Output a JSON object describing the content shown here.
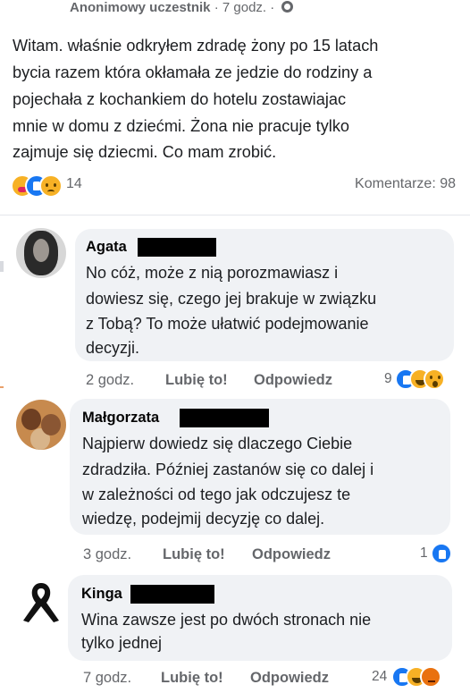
{
  "post": {
    "author": "Anonimowy uczestnik",
    "time": "7 godz.",
    "time_separator": "·",
    "lines": [
      "Witam. właśnie odkryłem zdradę żony po 15 latach",
      "bycia razem która okłamała  ze jedzie do rodziny a",
      "pojechała z kochankiem do hotelu zostawiajac",
      "mnie w domu z dziećmi. Żona nie pracuje tylko",
      "zajmuje się dziecmi. Co mam zrobić."
    ],
    "reaction_count": "14",
    "reaction_icons": [
      "care-icon",
      "like-icon",
      "sad-icon"
    ],
    "comments_label": "Komentarze: 98"
  },
  "comments": [
    {
      "name": "Agata",
      "lines": [
        "No cóż, może z nią porozmawiasz i",
        "dowiesz się, czego jej brakuje w związku",
        "z Tobą? To może ułatwić podejmowanie",
        "decyzji."
      ],
      "time": "2 godz.",
      "like_label": "Lubię to!",
      "reply_label": "Odpowiedz",
      "reaction_count": "9",
      "reaction_icons": [
        "like-icon",
        "haha-icon",
        "wow-icon"
      ]
    },
    {
      "name": "Małgorzata",
      "lines": [
        "Najpierw dowiedz się dlaczego Ciebie",
        "zdradziła. Później zastanów się co dalej i",
        "w zależności od tego jak odczujesz te",
        "wiedzę, podejmij decyzję co dalej."
      ],
      "time": "3 godz.",
      "like_label": "Lubię to!",
      "reply_label": "Odpowiedz",
      "reaction_count": "1",
      "reaction_icons": [
        "like-icon"
      ]
    },
    {
      "name": "Kinga",
      "lines": [
        "Wina zawsze jest po dwóch stronach nie",
        "tylko jednej"
      ],
      "time": "7 godz.",
      "like_label": "Lubię to!",
      "reply_label": "Odpowiedz",
      "reaction_count": "24",
      "reaction_icons": [
        "like-icon",
        "haha-icon",
        "angry-icon"
      ]
    }
  ],
  "colors": {
    "secondary_text": "#65676b",
    "bubble": "#f0f2f5",
    "like_blue": "#1877f2",
    "reaction_yellow": "#f7b125",
    "redaction": "#000000"
  }
}
